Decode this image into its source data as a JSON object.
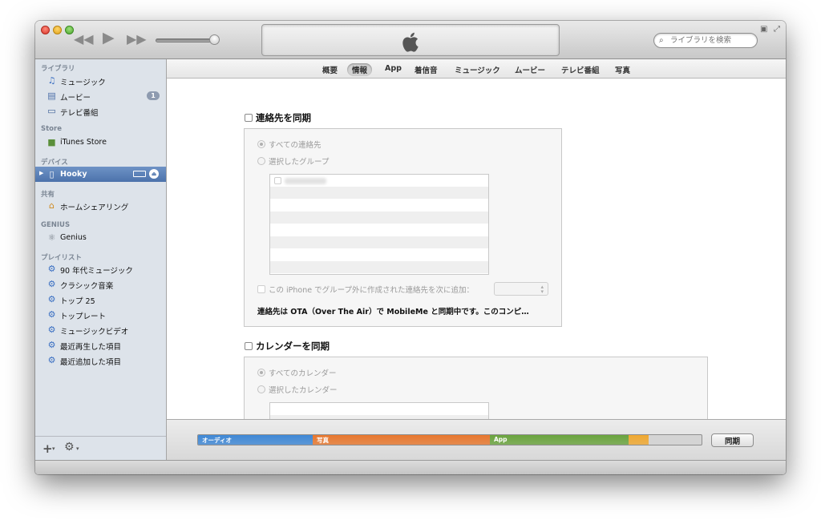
{
  "toolbar": {
    "search_placeholder": "ライブラリを検索",
    "apple_logo": "apple-icon"
  },
  "sidebar": {
    "sections": [
      {
        "heading": "ライブラリ",
        "items": [
          {
            "label": "ミュージック",
            "icon": "music-note-icon"
          },
          {
            "label": "ムービー",
            "icon": "film-icon",
            "badge": "1"
          },
          {
            "label": "テレビ番組",
            "icon": "tv-icon"
          }
        ]
      },
      {
        "heading": "Store",
        "items": [
          {
            "label": "iTunes Store",
            "icon": "store-bag-icon"
          }
        ]
      },
      {
        "heading": "デバイス",
        "items": [
          {
            "label": "Hooky",
            "icon": "iphone-icon",
            "selected": true
          }
        ]
      },
      {
        "heading": "共有",
        "items": [
          {
            "label": "ホームシェアリング",
            "icon": "home-icon"
          }
        ]
      },
      {
        "heading": "GENIUS",
        "items": [
          {
            "label": "Genius",
            "icon": "genius-atom-icon"
          }
        ]
      },
      {
        "heading": "プレイリスト",
        "items": [
          {
            "label": "90 年代ミュージック",
            "icon": "gear-icon"
          },
          {
            "label": "クラシック音楽",
            "icon": "gear-icon"
          },
          {
            "label": "トップ 25",
            "icon": "gear-icon"
          },
          {
            "label": "トップレート",
            "icon": "gear-icon"
          },
          {
            "label": "ミュージックビデオ",
            "icon": "gear-icon"
          },
          {
            "label": "最近再生した項目",
            "icon": "gear-icon"
          },
          {
            "label": "最近追加した項目",
            "icon": "gear-icon"
          }
        ]
      }
    ]
  },
  "tabs": [
    "概要",
    "情報",
    "App",
    "着信音",
    "ミュージック",
    "ムービー",
    "テレビ番組",
    "写真"
  ],
  "active_tab": "情報",
  "contacts": {
    "title": "連絡先を同期",
    "radio_all": "すべての連絡先",
    "radio_selected": "選択したグループ",
    "add_outside_label": "この iPhone でグループ外に作成された連絡先を次に追加：",
    "note": "連絡先は OTA（Over The Air）で MobileMe と同期中です。このコンピ…"
  },
  "calendars": {
    "title": "カレンダーを同期",
    "radio_all": "すべてのカレンダー",
    "radio_selected": "選択したカレンダー"
  },
  "capacity": {
    "segments": [
      {
        "label": "オーディオ",
        "color": "#3f88d6",
        "fraction": 0.228
      },
      {
        "label": "写真",
        "color": "#e8772e",
        "fraction": 0.352
      },
      {
        "label": "App",
        "color": "#6aa43e",
        "fraction": 0.275
      },
      {
        "label": "",
        "color": "#f0a830",
        "fraction": 0.04
      }
    ],
    "sync_button": "同期"
  }
}
